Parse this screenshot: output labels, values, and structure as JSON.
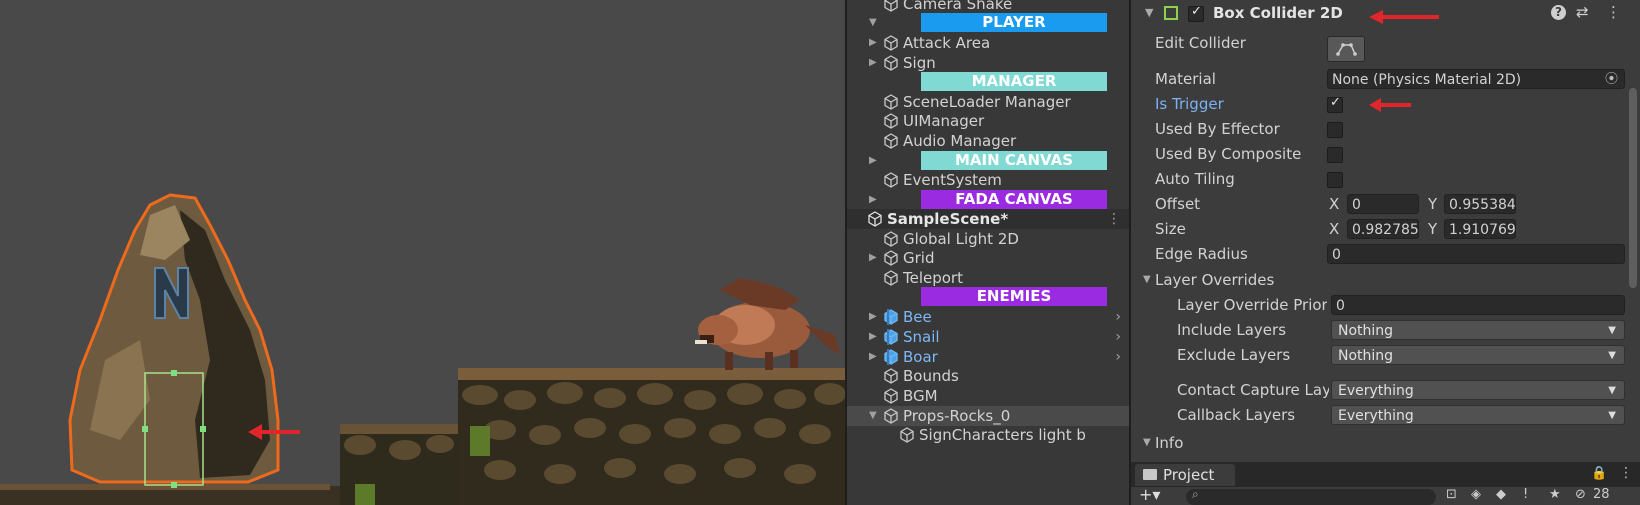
{
  "hierarchy": {
    "rows": [
      {
        "label": "Camera Shake",
        "kind": "obj"
      },
      {
        "label": "PLAYER",
        "kind": "banner",
        "color": "#1a9bf0"
      },
      {
        "label": "Attack Area",
        "kind": "obj"
      },
      {
        "label": "Sign",
        "kind": "obj"
      },
      {
        "label": "MANAGER",
        "kind": "banner",
        "color": "#80d9d2"
      },
      {
        "label": "SceneLoader Manager",
        "kind": "obj"
      },
      {
        "label": "UIManager",
        "kind": "obj"
      },
      {
        "label": "Audio Manager",
        "kind": "obj"
      },
      {
        "label": "MAIN CANVAS",
        "kind": "banner",
        "color": "#80d9d2"
      },
      {
        "label": "EventSystem",
        "kind": "obj"
      },
      {
        "label": "FADA CANVAS",
        "kind": "banner",
        "color": "#9a2be0"
      },
      {
        "label": "SampleScene*",
        "kind": "scene"
      },
      {
        "label": "Global Light 2D",
        "kind": "obj"
      },
      {
        "label": "Grid",
        "kind": "obj"
      },
      {
        "label": "Teleport",
        "kind": "obj"
      },
      {
        "label": "ENEMIES",
        "kind": "banner",
        "color": "#9a2be0"
      },
      {
        "label": "Bee",
        "kind": "prefab"
      },
      {
        "label": "Snail",
        "kind": "prefab"
      },
      {
        "label": "Boar",
        "kind": "prefab"
      },
      {
        "label": "Bounds",
        "kind": "obj"
      },
      {
        "label": "BGM",
        "kind": "obj"
      },
      {
        "label": "Props-Rocks_0",
        "kind": "obj"
      },
      {
        "label": "SignCharacters light b",
        "kind": "obj"
      }
    ]
  },
  "inspector": {
    "component_title": "Box Collider 2D",
    "edit_collider": "Edit Collider",
    "material_label": "Material",
    "material_value": "None (Physics Material 2D)",
    "is_trigger": "Is Trigger",
    "used_by_effector": "Used By Effector",
    "used_by_composite": "Used By Composite",
    "auto_tiling": "Auto Tiling",
    "offset_label": "Offset",
    "offset_x": "0",
    "offset_y": "0.955384",
    "size_label": "Size",
    "size_x": "0.982785",
    "size_y": "1.910769",
    "edge_radius_label": "Edge Radius",
    "edge_radius_value": "0",
    "layer_overrides": "Layer Overrides",
    "layer_override_priority": "Layer Override Priori",
    "layer_override_priority_value": "0",
    "include_layers": "Include Layers",
    "include_layers_value": "Nothing",
    "exclude_layers": "Exclude Layers",
    "exclude_layers_value": "Nothing",
    "contact_capture": "Contact Capture Laye",
    "contact_capture_value": "Everything",
    "callback_layers": "Callback Layers",
    "callback_layers_value": "Everything",
    "info": "Info",
    "x": "X",
    "y": "Y"
  },
  "project": {
    "tab": "Project",
    "count": "28"
  },
  "colors": {
    "accent_red": "#e0262b",
    "trigger_blue": "#7cb1f2",
    "scene_bg": "#494949"
  }
}
